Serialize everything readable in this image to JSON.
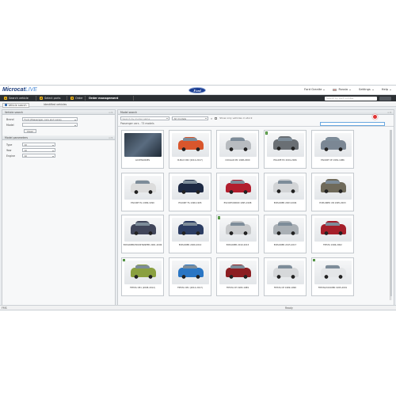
{
  "app": {
    "logo_main": "Microcat",
    "logo_suffix": "LIVE",
    "brand_badge": "Ford",
    "top_menu": [
      {
        "label": "Ford Granite"
      },
      {
        "label": "Russia",
        "flag": true
      },
      {
        "label": "Settings"
      },
      {
        "label": "Help"
      }
    ]
  },
  "tabs": [
    {
      "num": "1",
      "label": "Search vehicle",
      "active": false
    },
    {
      "num": "2",
      "label": "Select parts",
      "active": false
    },
    {
      "num": "3",
      "label": "Order",
      "active": false
    },
    {
      "label": "Order management",
      "active": true
    }
  ],
  "tab_search_placeholder": "Search by part number",
  "subtabs": [
    {
      "label": "Vehicle search",
      "active": true
    },
    {
      "label": "Identified vehicles",
      "active": false
    }
  ],
  "left_panel": {
    "title": "Vehicle search",
    "fields": [
      {
        "label": "Brand",
        "value": "Ford (Passenger cars and vans)"
      },
      {
        "label": "Model",
        "value": ""
      }
    ],
    "reset_label": "Clear",
    "section2_title": "Model parameters",
    "section2_fields": [
      {
        "label": "Type",
        "value": "All"
      },
      {
        "label": "Year",
        "value": "All"
      },
      {
        "label": "Engine",
        "value": "All"
      }
    ]
  },
  "right_panel": {
    "title": "Model search",
    "select1_placeholder": "Search by model name",
    "select2_value": "All models",
    "checkbox_label": "Show only vehicles in stock",
    "subheader": "Passenger cars - 73 models",
    "filter_placeholder": ""
  },
  "vehicles": [
    {
      "label": "ACCESSORIES",
      "color": "#2f3b47",
      "kind": "photo",
      "tag": false
    },
    {
      "label": "B-MAX CB2 (2012-2017)",
      "color": "#d9562c",
      "kind": "car",
      "tag": false
    },
    {
      "label": "COUGAR MC 1998-2000",
      "color": "#b8bcc0",
      "kind": "car",
      "tag": false
    },
    {
      "label": "ESCAPE EC 2001-2006",
      "color": "#6a6f74",
      "kind": "suv",
      "tag": true
    },
    {
      "label": "ESCORT CE 1981-1986",
      "color": "#7b8794",
      "kind": "car",
      "tag": false
    },
    {
      "label": "ESCORT EA 1986-1990",
      "color": "#dcdcdc",
      "kind": "car",
      "tag": false
    },
    {
      "label": "ESCORT FA 1990-1995",
      "color": "#1e2a44",
      "kind": "car",
      "tag": false
    },
    {
      "label": "ESCORT/ORION 1995-1998",
      "color": "#b21e2e",
      "kind": "car",
      "tag": false
    },
    {
      "label": "EXPLORER 2003-2006",
      "color": "#d2d4d6",
      "kind": "suv",
      "tag": false
    },
    {
      "label": "EXPLORER UN 1995-2003",
      "color": "#6f6a5a",
      "kind": "suv",
      "tag": false
    },
    {
      "label": "EXPLORER/MOUNTAINEER 2001-2006",
      "color": "#41465a",
      "kind": "suv",
      "tag": false
    },
    {
      "label": "EXPLORER 2006-2010",
      "color": "#2c3d63",
      "kind": "suv",
      "tag": false
    },
    {
      "label": "EXPLORER 2010-2015",
      "color": "#c7c9cb",
      "kind": "suv",
      "tag": true
    },
    {
      "label": "EXPLORER 2015-2017",
      "color": "#aab0b5",
      "kind": "suv",
      "tag": false
    },
    {
      "label": "FIESTA 1996-2002",
      "color": "#a51f2a",
      "kind": "suv",
      "tag": false
    },
    {
      "label": "FIESTA CB1 (2008-2012)",
      "color": "#8aa040",
      "kind": "car",
      "tag": true
    },
    {
      "label": "FIESTA CB1 (2012-2017)",
      "color": "#2a76c4",
      "kind": "car",
      "tag": false
    },
    {
      "label": "FIESTA CE 1983-1989",
      "color": "#8c1e22",
      "kind": "car",
      "tag": false
    },
    {
      "label": "FIESTA CE 1989-1996",
      "color": "#d6d8da",
      "kind": "car",
      "tag": false
    },
    {
      "label": "FIESTA/COURIER 1995-2001",
      "color": "#e4e6e8",
      "kind": "car",
      "tag": true
    }
  ],
  "statusbar": {
    "left": "FMS",
    "center": "Ready"
  }
}
